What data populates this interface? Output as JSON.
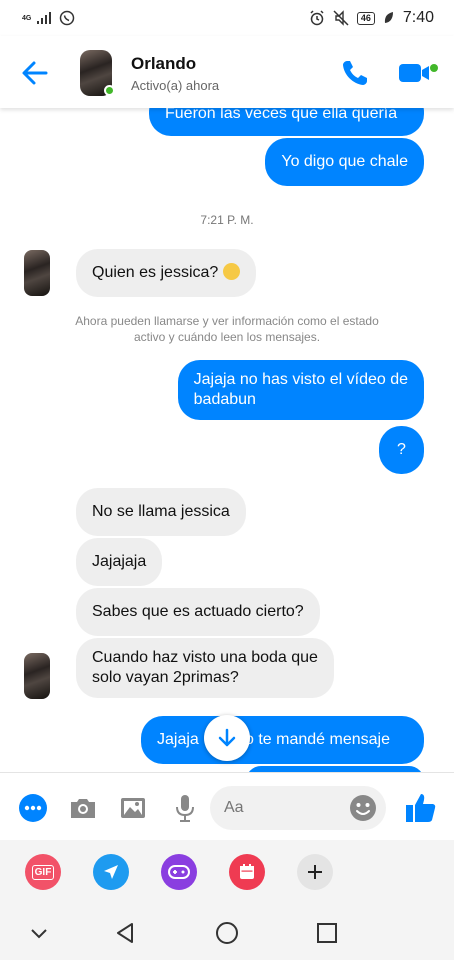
{
  "status_bar": {
    "network": "4G",
    "battery": "46",
    "time": "7:40"
  },
  "header": {
    "contact_name": "Orlando",
    "status": "Activo(a) ahora"
  },
  "messages": [
    {
      "side": "out",
      "text": "Fueron las veces que ella quería"
    },
    {
      "side": "out",
      "text": "Yo digo que chale"
    },
    {
      "side": "in",
      "text": "Quien es jessica?"
    },
    {
      "side": "out",
      "text": "Jajaja no has visto el vídeo de"
    },
    {
      "side": "out",
      "text": "badabun"
    },
    {
      "side": "out",
      "text": "?"
    },
    {
      "side": "in",
      "text": "No se llama jessica"
    },
    {
      "side": "in",
      "text": "Jajajaja"
    },
    {
      "side": "in",
      "text": "Sabes que es actuado cierto?"
    },
    {
      "side": "in",
      "text": "Cuando haz visto una boda que"
    },
    {
      "side": "in",
      "text": "solo vayan 2primas?"
    },
    {
      "side": "out",
      "text": "Jajaja"
    },
    {
      "side": "out",
      "text": "so te mandé mensaje"
    }
  ],
  "timestamp": "7:21 P. M.",
  "notice": "Ahora pueden llamarse y ver información como el estado activo y cuándo leen los mensajes.",
  "composer": {
    "placeholder": "Aa"
  },
  "tray": {
    "gif_label": "GIF"
  },
  "colors": {
    "accent": "#0084ff",
    "online": "#42b72a",
    "incoming_bubble": "#eeeeee"
  },
  "icons": [
    "back-arrow-icon",
    "phone-icon",
    "video-camera-icon",
    "more-dots-icon",
    "camera-icon",
    "image-icon",
    "microphone-icon",
    "emoji-icon",
    "thumbs-up-icon",
    "gif-icon",
    "location-icon",
    "game-icon",
    "calendar-icon",
    "plus-icon",
    "arrow-down-icon",
    "nav-collapse-icon",
    "nav-back-icon",
    "nav-home-icon",
    "nav-recents-icon"
  ]
}
